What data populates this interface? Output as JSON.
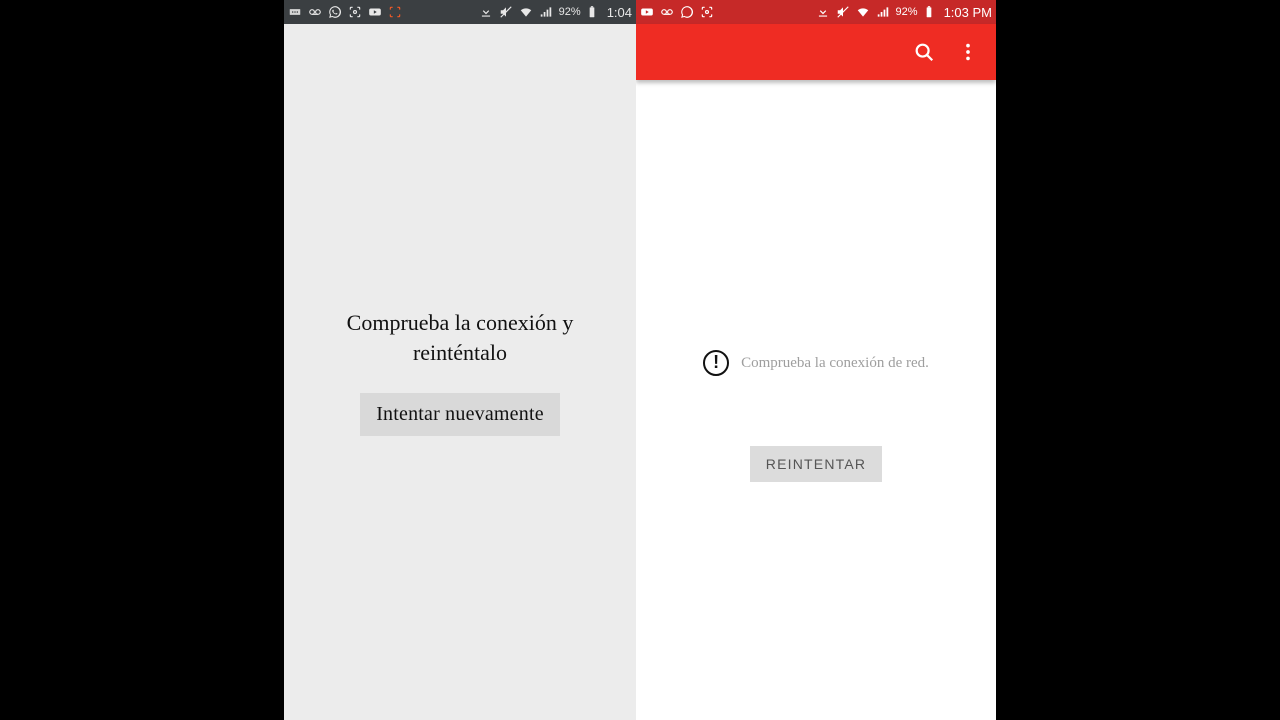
{
  "left": {
    "statusbar": {
      "battery_pct": "92%",
      "time": "1:04"
    },
    "error_message": "Comprueba la conexión y reinténtalo",
    "retry_label": "Intentar nuevamente"
  },
  "right": {
    "statusbar": {
      "battery_pct": "92%",
      "time": "1:03 PM"
    },
    "error_message": "Comprueba la conexión de red.",
    "retry_label": "REINTENTAR"
  }
}
